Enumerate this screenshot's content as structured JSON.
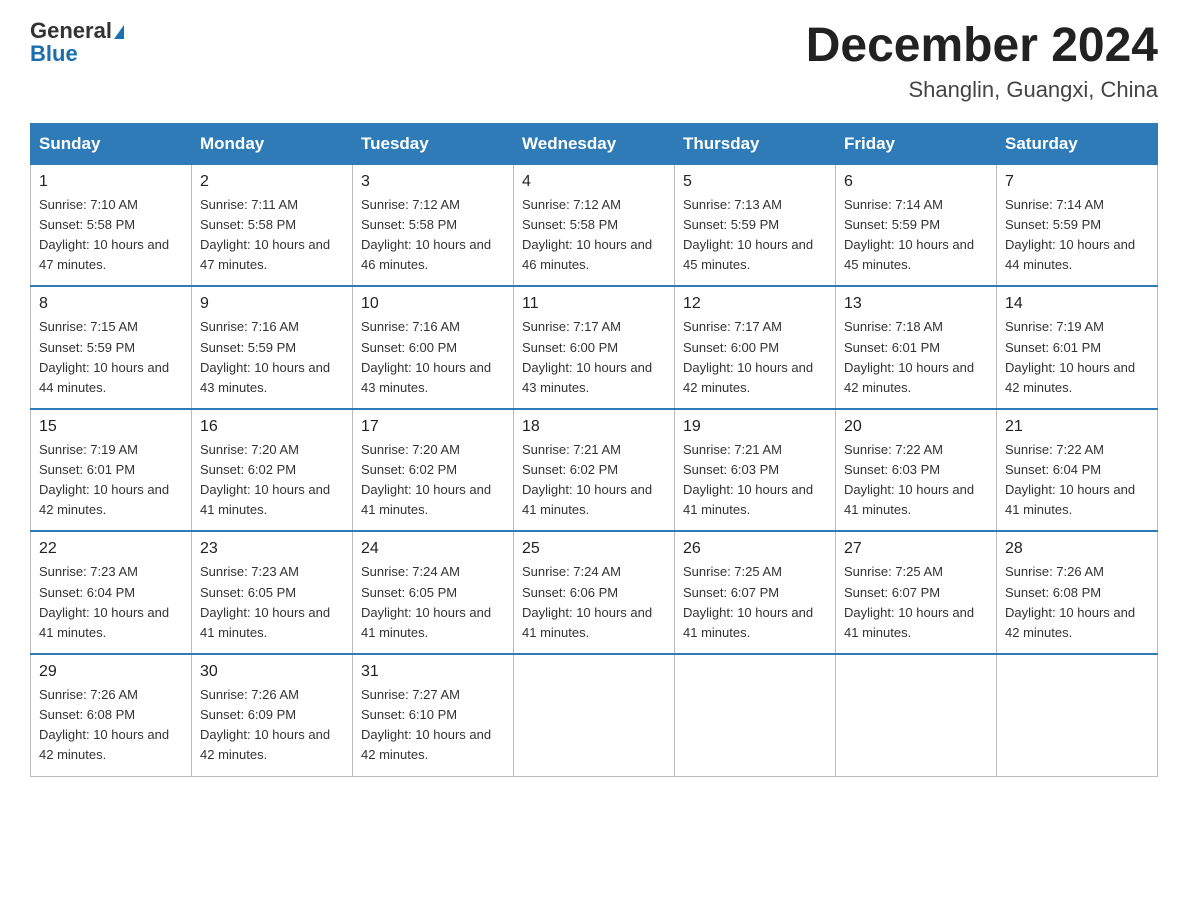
{
  "header": {
    "logo_general": "General",
    "logo_blue": "Blue",
    "title": "December 2024",
    "location": "Shanglin, Guangxi, China"
  },
  "weekdays": [
    "Sunday",
    "Monday",
    "Tuesday",
    "Wednesday",
    "Thursday",
    "Friday",
    "Saturday"
  ],
  "weeks": [
    [
      {
        "day": "1",
        "sunrise": "7:10 AM",
        "sunset": "5:58 PM",
        "daylight": "10 hours and 47 minutes."
      },
      {
        "day": "2",
        "sunrise": "7:11 AM",
        "sunset": "5:58 PM",
        "daylight": "10 hours and 47 minutes."
      },
      {
        "day": "3",
        "sunrise": "7:12 AM",
        "sunset": "5:58 PM",
        "daylight": "10 hours and 46 minutes."
      },
      {
        "day": "4",
        "sunrise": "7:12 AM",
        "sunset": "5:58 PM",
        "daylight": "10 hours and 46 minutes."
      },
      {
        "day": "5",
        "sunrise": "7:13 AM",
        "sunset": "5:59 PM",
        "daylight": "10 hours and 45 minutes."
      },
      {
        "day": "6",
        "sunrise": "7:14 AM",
        "sunset": "5:59 PM",
        "daylight": "10 hours and 45 minutes."
      },
      {
        "day": "7",
        "sunrise": "7:14 AM",
        "sunset": "5:59 PM",
        "daylight": "10 hours and 44 minutes."
      }
    ],
    [
      {
        "day": "8",
        "sunrise": "7:15 AM",
        "sunset": "5:59 PM",
        "daylight": "10 hours and 44 minutes."
      },
      {
        "day": "9",
        "sunrise": "7:16 AM",
        "sunset": "5:59 PM",
        "daylight": "10 hours and 43 minutes."
      },
      {
        "day": "10",
        "sunrise": "7:16 AM",
        "sunset": "6:00 PM",
        "daylight": "10 hours and 43 minutes."
      },
      {
        "day": "11",
        "sunrise": "7:17 AM",
        "sunset": "6:00 PM",
        "daylight": "10 hours and 43 minutes."
      },
      {
        "day": "12",
        "sunrise": "7:17 AM",
        "sunset": "6:00 PM",
        "daylight": "10 hours and 42 minutes."
      },
      {
        "day": "13",
        "sunrise": "7:18 AM",
        "sunset": "6:01 PM",
        "daylight": "10 hours and 42 minutes."
      },
      {
        "day": "14",
        "sunrise": "7:19 AM",
        "sunset": "6:01 PM",
        "daylight": "10 hours and 42 minutes."
      }
    ],
    [
      {
        "day": "15",
        "sunrise": "7:19 AM",
        "sunset": "6:01 PM",
        "daylight": "10 hours and 42 minutes."
      },
      {
        "day": "16",
        "sunrise": "7:20 AM",
        "sunset": "6:02 PM",
        "daylight": "10 hours and 41 minutes."
      },
      {
        "day": "17",
        "sunrise": "7:20 AM",
        "sunset": "6:02 PM",
        "daylight": "10 hours and 41 minutes."
      },
      {
        "day": "18",
        "sunrise": "7:21 AM",
        "sunset": "6:02 PM",
        "daylight": "10 hours and 41 minutes."
      },
      {
        "day": "19",
        "sunrise": "7:21 AM",
        "sunset": "6:03 PM",
        "daylight": "10 hours and 41 minutes."
      },
      {
        "day": "20",
        "sunrise": "7:22 AM",
        "sunset": "6:03 PM",
        "daylight": "10 hours and 41 minutes."
      },
      {
        "day": "21",
        "sunrise": "7:22 AM",
        "sunset": "6:04 PM",
        "daylight": "10 hours and 41 minutes."
      }
    ],
    [
      {
        "day": "22",
        "sunrise": "7:23 AM",
        "sunset": "6:04 PM",
        "daylight": "10 hours and 41 minutes."
      },
      {
        "day": "23",
        "sunrise": "7:23 AM",
        "sunset": "6:05 PM",
        "daylight": "10 hours and 41 minutes."
      },
      {
        "day": "24",
        "sunrise": "7:24 AM",
        "sunset": "6:05 PM",
        "daylight": "10 hours and 41 minutes."
      },
      {
        "day": "25",
        "sunrise": "7:24 AM",
        "sunset": "6:06 PM",
        "daylight": "10 hours and 41 minutes."
      },
      {
        "day": "26",
        "sunrise": "7:25 AM",
        "sunset": "6:07 PM",
        "daylight": "10 hours and 41 minutes."
      },
      {
        "day": "27",
        "sunrise": "7:25 AM",
        "sunset": "6:07 PM",
        "daylight": "10 hours and 41 minutes."
      },
      {
        "day": "28",
        "sunrise": "7:26 AM",
        "sunset": "6:08 PM",
        "daylight": "10 hours and 42 minutes."
      }
    ],
    [
      {
        "day": "29",
        "sunrise": "7:26 AM",
        "sunset": "6:08 PM",
        "daylight": "10 hours and 42 minutes."
      },
      {
        "day": "30",
        "sunrise": "7:26 AM",
        "sunset": "6:09 PM",
        "daylight": "10 hours and 42 minutes."
      },
      {
        "day": "31",
        "sunrise": "7:27 AM",
        "sunset": "6:10 PM",
        "daylight": "10 hours and 42 minutes."
      },
      null,
      null,
      null,
      null
    ]
  ],
  "labels": {
    "sunrise_prefix": "Sunrise: ",
    "sunset_prefix": "Sunset: ",
    "daylight_prefix": "Daylight: "
  }
}
